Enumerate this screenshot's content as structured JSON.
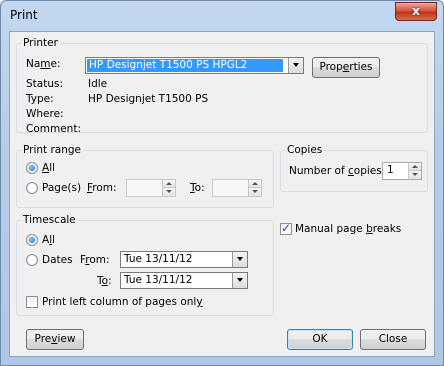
{
  "window": {
    "title": "Print",
    "close_glyph": "x"
  },
  "printer": {
    "group_label": "Printer",
    "name_label": "Name:",
    "name_value": "HP Designjet T1500 PS HPGL2",
    "properties_label": "Properties",
    "status_label": "Status:",
    "status_value": "Idle",
    "type_label": "Type:",
    "type_value": "HP Designjet T1500 PS",
    "where_label": "Where:",
    "where_value": "",
    "comment_label": "Comment:",
    "comment_value": ""
  },
  "print_range": {
    "group_label": "Print range",
    "all_label": "All",
    "all_selected": true,
    "pages_label": "Page(s)",
    "from_label": "From:",
    "from_value": "",
    "to_label": "To:",
    "to_value": ""
  },
  "copies": {
    "group_label": "Copies",
    "number_label": "Number of copies:",
    "number_value": "1"
  },
  "timescale": {
    "group_label": "Timescale",
    "all_label": "All",
    "all_selected": true,
    "dates_label": "Dates",
    "from_label": "From:",
    "from_value": "Tue 13/11/12",
    "to_label": "To:",
    "to_value": "Tue 13/11/12",
    "left_column_label": "Print left column of pages only",
    "left_column_checked": false
  },
  "manual_page_breaks": {
    "label": "Manual page breaks",
    "checked": true
  },
  "buttons": {
    "preview": "Preview",
    "ok": "OK",
    "close": "Close"
  },
  "colors": {
    "selection": "#3399ff",
    "title_gradient": "#b5cde9",
    "close_red": "#c2351d"
  }
}
